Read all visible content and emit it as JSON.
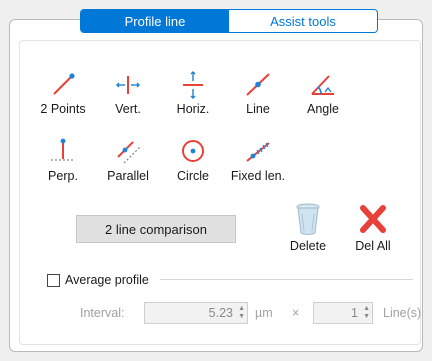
{
  "tabs": [
    {
      "label": "Profile line",
      "active": true
    },
    {
      "label": "Assist tools",
      "active": false
    }
  ],
  "tools": [
    {
      "label": "2 Points",
      "icon": "two-points-icon"
    },
    {
      "label": "Vert.",
      "icon": "vertical-icon"
    },
    {
      "label": "Horiz.",
      "icon": "horizontal-icon"
    },
    {
      "label": "Line",
      "icon": "line-icon"
    },
    {
      "label": "Angle",
      "icon": "angle-icon"
    },
    {
      "label": "Perp.",
      "icon": "perpendicular-icon"
    },
    {
      "label": "Parallel",
      "icon": "parallel-icon"
    },
    {
      "label": "Circle",
      "icon": "circle-icon"
    },
    {
      "label": "Fixed len.",
      "icon": "fixed-length-icon"
    }
  ],
  "actions": {
    "compare_label": "2 line comparison",
    "delete_label": "Delete",
    "delete_all_label": "Del All"
  },
  "average": {
    "label": "Average profile",
    "checked": false,
    "interval_label": "Interval:",
    "interval_value": "5.23",
    "interval_unit": "µm",
    "times": "×",
    "lines_value": "1",
    "lines_unit": "Line(s)"
  },
  "colors": {
    "accent": "#0078d7",
    "tool_red": "#e8413a",
    "tool_blue": "#1f83d6"
  }
}
